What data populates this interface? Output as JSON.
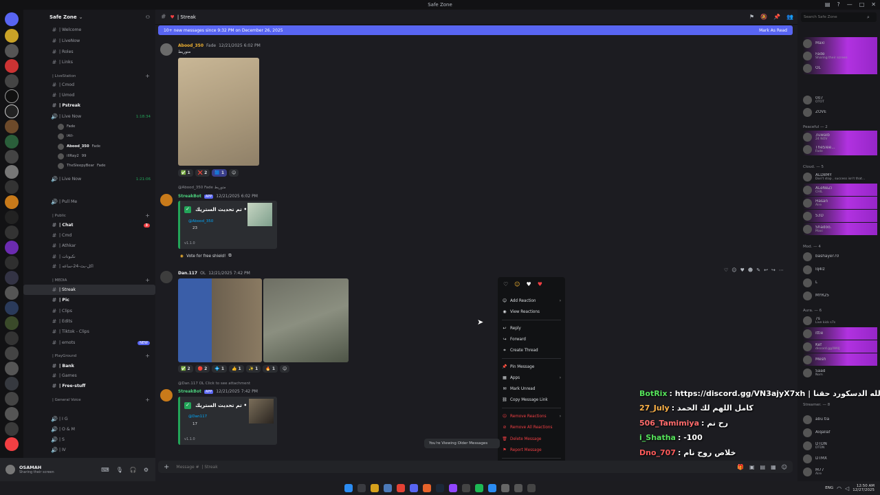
{
  "window": {
    "title": "Safe Zone"
  },
  "server": {
    "name": "Safe Zone",
    "name_chevron": "⌄"
  },
  "channels": [
    {
      "label": "| Welcome",
      "type": "channel"
    },
    {
      "label": "| LiveNow",
      "type": "channel"
    },
    {
      "label": "| Roles",
      "type": "channel"
    },
    {
      "label": "| Links",
      "type": "channel"
    },
    {
      "label": "| LiveStation",
      "type": "category"
    },
    {
      "label": "| Cmod",
      "type": "channel"
    },
    {
      "label": "| Umod",
      "type": "channel"
    },
    {
      "label": "| Pstreak",
      "type": "channel",
      "unread": true
    },
    {
      "label": "| Live Now",
      "type": "voice",
      "time": "1:18:34"
    },
    {
      "label": "| Live Now",
      "type": "voice",
      "time": "1:21:06"
    },
    {
      "label": "| Pull Me",
      "type": "voice"
    },
    {
      "label": "| Public",
      "type": "category"
    },
    {
      "label": "| Chat",
      "type": "channel",
      "unread": true,
      "badge": "3"
    },
    {
      "label": "| Cmd",
      "type": "channel"
    },
    {
      "label": "| Athkar",
      "type": "channel"
    },
    {
      "label": "| نكبوتات",
      "type": "channel"
    },
    {
      "label": "| اكل-بث-24-ساعه",
      "type": "channel"
    },
    {
      "label": "| MEDIA",
      "type": "category"
    },
    {
      "label": "| Streak",
      "type": "channel",
      "active": true
    },
    {
      "label": "| Pic",
      "type": "channel",
      "unread": true
    },
    {
      "label": "| Clips",
      "type": "channel"
    },
    {
      "label": "| Edits",
      "type": "channel"
    },
    {
      "label": "| Tiktok - Clips",
      "type": "channel"
    },
    {
      "label": "| emots",
      "type": "channel",
      "badge": "NEW"
    },
    {
      "label": "| PlayGround",
      "type": "category"
    },
    {
      "label": "| Bank",
      "type": "channel",
      "unread": true
    },
    {
      "label": "| Games",
      "type": "channel"
    },
    {
      "label": "| Free-stuff",
      "type": "channel",
      "unread": true
    },
    {
      "label": "| General Voice",
      "type": "category"
    },
    {
      "label": "| I G",
      "type": "voice"
    },
    {
      "label": "| O & M",
      "type": "voice"
    },
    {
      "label": "| S",
      "type": "voice"
    },
    {
      "label": "| Ⅳ",
      "type": "voice"
    }
  ],
  "voice_users": [
    {
      "name": "Fade"
    },
    {
      "name": "lAll-"
    },
    {
      "name": "Abood_350",
      "tag": "Fade"
    },
    {
      "name": "illRay2",
      "tag": "99"
    },
    {
      "name": "TheSleepyBear",
      "tag": "Fade"
    }
  ],
  "user_panel": {
    "name": "OSAMAH",
    "status": "Sharing their screen"
  },
  "header": {
    "channel": "| Streak"
  },
  "banner": {
    "text": "10+ new messages since 9:32 PM on December 26, 2025",
    "action": "Mark As Read"
  },
  "messages": [
    {
      "author": "Abood_350",
      "tag": "Fade",
      "time": "12/21/2025 6:02 PM",
      "text": "متوريط",
      "reactions": [
        {
          "emoji": "✅",
          "count": "1"
        },
        {
          "emoji": "❌",
          "count": "2"
        },
        {
          "emoji": "🟦",
          "count": "1"
        }
      ]
    },
    {
      "author": "StreakBot",
      "badge": "APP",
      "time": "12/21/2025 6:02 PM",
      "reply": "@Abood_350 Fade متوريط",
      "embed_title": "تم تحديث الستريك •",
      "embed_user": "@Abood_350",
      "embed_line1": "23",
      "embed_version": "v1.1.0",
      "button": "Vote for free shield!"
    },
    {
      "author": "Dan.117",
      "tag": "OL",
      "time": "12/21/2025 7:42 PM",
      "reactions": [
        {
          "emoji": "✅",
          "count": "2"
        },
        {
          "emoji": "🔴",
          "count": "2"
        },
        {
          "emoji": "💠",
          "count": "1"
        },
        {
          "emoji": "👍",
          "count": "1"
        },
        {
          "emoji": "✨",
          "count": "1"
        },
        {
          "emoji": "🔥",
          "count": "1"
        }
      ]
    },
    {
      "author": "StreakBot",
      "badge": "APP",
      "time": "12/21/2025 7:42 PM",
      "reply": "@Dan.117 OL Click to see attachment",
      "embed_title": "تم تحديث الستريك •",
      "embed_user": "@Dan117",
      "embed_line1": "17",
      "embed_version": "v1.1.0"
    }
  ],
  "context_menu": {
    "items": [
      {
        "label": "Add Reaction",
        "icon": "smile-icon",
        "submenu": true
      },
      {
        "label": "View Reactions",
        "icon": "eye-icon"
      },
      {
        "label": "Reply",
        "icon": "reply-icon"
      },
      {
        "label": "Forward",
        "icon": "forward-icon"
      },
      {
        "label": "Create Thread",
        "icon": "thread-icon"
      },
      {
        "label": "Pin Message",
        "icon": "pin-icon"
      },
      {
        "label": "Apps",
        "icon": "apps-icon",
        "submenu": true
      },
      {
        "label": "Mark Unread",
        "icon": "unread-icon"
      },
      {
        "label": "Copy Message Link",
        "icon": "link-icon"
      },
      {
        "label": "Remove Reactions",
        "icon": "remove-reaction-icon",
        "submenu": true,
        "danger": true
      },
      {
        "label": "Remove All Reactions",
        "icon": "remove-all-icon",
        "danger": true
      },
      {
        "label": "Delete Message",
        "icon": "trash-icon",
        "danger": true
      },
      {
        "label": "Report Message",
        "icon": "flag-icon",
        "danger": true
      },
      {
        "label": "Copy Message ID",
        "icon": "id-icon"
      }
    ]
  },
  "older_notice": "You're Viewing Older Messages",
  "composer": {
    "placeholder": "Message #  | Streak"
  },
  "search": {
    "placeholder": "Search Safe Zone"
  },
  "member_categories": [
    {
      "label": "Peaceful — 2"
    },
    {
      "label": "Cloud. — 5"
    },
    {
      "label": "Mod. — 4"
    },
    {
      "label": "Aura. — 6"
    },
    {
      "label": "Streamer. — 8"
    }
  ],
  "members": [
    {
      "name": "Maxi",
      "status": ""
    },
    {
      "name": "Fade",
      "status": "Sharing their screen"
    },
    {
      "name": "OL",
      "status": ""
    },
    {
      "name": "007",
      "status": "OTOT"
    },
    {
      "name": "ZOVE",
      "status": ""
    },
    {
      "name": "3uwaib",
      "status": "24 NOV"
    },
    {
      "name": "TheSlee...",
      "status": "Fade"
    },
    {
      "name": "ALD8MY",
      "status": "Don't stop , success isn't that..."
    },
    {
      "name": "ALeNeZi",
      "status": "CHIL"
    },
    {
      "name": "Hasan",
      "status": "Aire"
    },
    {
      "name": "S3D",
      "status": ""
    },
    {
      "name": "Shadoo.",
      "status": "Maxi"
    },
    {
      "name": "bashayer70",
      "status": ""
    },
    {
      "name": "lq4lz",
      "status": ""
    },
    {
      "name": "L",
      "status": ""
    },
    {
      "name": "MYR25",
      "status": ""
    },
    {
      "name": "7s",
      "status": "Live kick s7s"
    },
    {
      "name": "ittie",
      "status": ""
    },
    {
      "name": "Kef",
      "status": "discord.gg/WAIJ"
    },
    {
      "name": "Mesh",
      "status": ""
    },
    {
      "name": "Saad",
      "status": "Nom"
    },
    {
      "name": "abu tia",
      "status": ""
    },
    {
      "name": "Alqallaf",
      "status": ""
    },
    {
      "name": "DTDN",
      "status": "DTDN"
    },
    {
      "name": "DTMX",
      "status": ""
    },
    {
      "name": "M77",
      "status": "Aire"
    }
  ],
  "chat_overlay": [
    {
      "user": "BotRix",
      "text": ": https://discord.gg/VN3ajyX7xh | الله الدسكورد حقنا",
      "color": "#55e35a"
    },
    {
      "user": "27_July",
      "text": ": كامل اللهم لك الحمد",
      "color": "#ffb347"
    },
    {
      "user": "506_Tamimiya",
      "text": ": رح نم",
      "color": "#ff6b6b"
    },
    {
      "user": "i_Shatha",
      "text": ": -100",
      "color": "#55e35a"
    },
    {
      "user": "Dno_707",
      "text": ": خلاص روح نام",
      "color": "#ff5a5a"
    }
  ],
  "tray": {
    "lang": "ENG",
    "time": "12:50 AM",
    "date": "12/27/2025"
  },
  "colors": {
    "accent": "#5865f2",
    "green": "#23a559",
    "danger": "#f23f43",
    "highlight": "#b132e0"
  }
}
